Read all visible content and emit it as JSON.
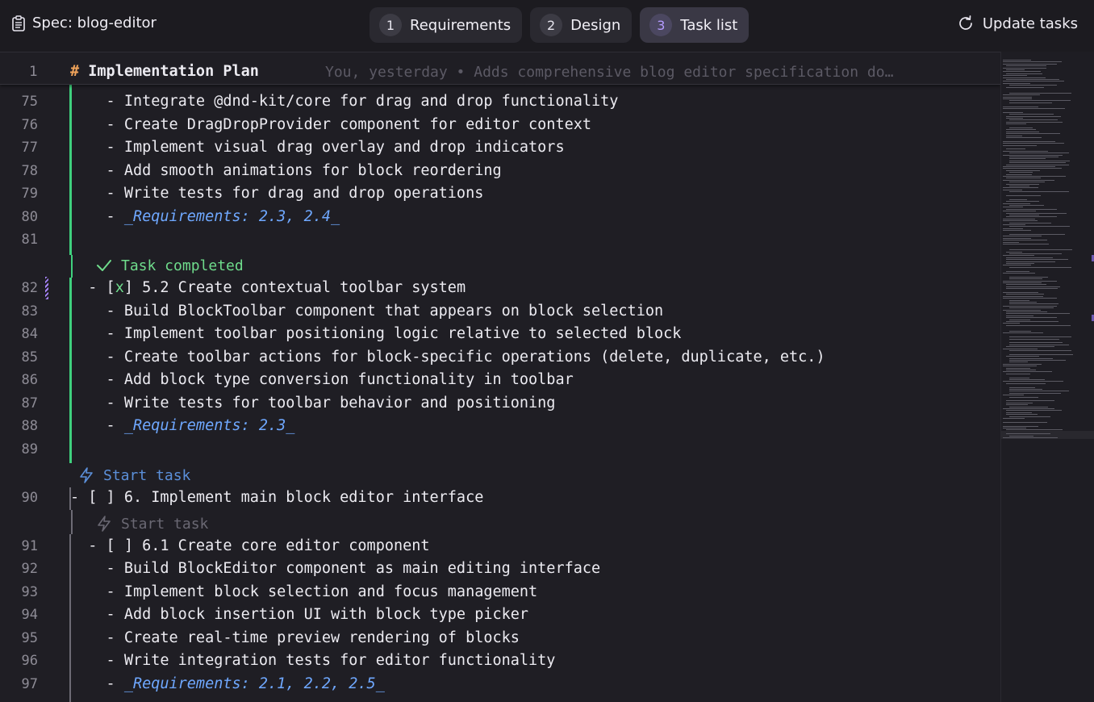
{
  "header": {
    "spec_title": "Spec: blog-editor",
    "tabs": [
      {
        "num": "1",
        "label": "Requirements"
      },
      {
        "num": "2",
        "label": "Design"
      },
      {
        "num": "3",
        "label": "Task list"
      }
    ],
    "update_label": "Update tasks"
  },
  "sticky": {
    "line_number": "1",
    "hash": "#",
    "text": " Implementation Plan",
    "blame": "You, yesterday • Adds comprehensive blog editor specification do…"
  },
  "lines": [
    {
      "n": "75",
      "t": "    - Integrate @dnd-kit/core for drag and drop functionality"
    },
    {
      "n": "76",
      "t": "    - Create DragDropProvider component for editor context"
    },
    {
      "n": "77",
      "t": "    - Implement visual drag overlay and drop indicators"
    },
    {
      "n": "78",
      "t": "    - Add smooth animations for block reordering"
    },
    {
      "n": "79",
      "t": "    - Write tests for drag and drop operations"
    },
    {
      "n": "80",
      "p": "    - ",
      "r": "_Requirements: 2.3, 2.4_"
    },
    {
      "n": "81",
      "t": ""
    },
    {
      "n": "82",
      "p": "  - [",
      "x": "x",
      "s": "] 5.2 Create contextual toolbar system"
    },
    {
      "n": "83",
      "t": "    - Build BlockToolbar component that appears on block selection"
    },
    {
      "n": "84",
      "t": "    - Implement toolbar positioning logic relative to selected block"
    },
    {
      "n": "85",
      "t": "    - Create toolbar actions for block-specific operations (delete, duplicate, etc.)"
    },
    {
      "n": "86",
      "t": "    - Add block type conversion functionality in toolbar"
    },
    {
      "n": "87",
      "t": "    - Write tests for toolbar behavior and positioning"
    },
    {
      "n": "88",
      "p": "    - ",
      "r": "_Requirements: 2.3_"
    },
    {
      "n": "89",
      "t": ""
    },
    {
      "n": "90",
      "t": "- [ ] 6. Implement main block editor interface"
    },
    {
      "n": "91",
      "t": "  - [ ] 6.1 Create core editor component"
    },
    {
      "n": "92",
      "t": "    - Build BlockEditor component as main editing interface"
    },
    {
      "n": "93",
      "t": "    - Implement block selection and focus management"
    },
    {
      "n": "94",
      "t": "    - Add block insertion UI with block type picker"
    },
    {
      "n": "95",
      "t": "    - Create real-time preview rendering of blocks"
    },
    {
      "n": "96",
      "t": "    - Write integration tests for editor functionality"
    },
    {
      "n": "97",
      "p": "    - ",
      "r": "_Requirements: 2.1, 2.2, 2.5_"
    }
  ],
  "codelens": {
    "task_completed": "Task completed",
    "start_task_6": "Start task",
    "start_task_61": "Start task"
  },
  "colors": {
    "background": "#1f1e24",
    "accent": "#b49bff",
    "green": "#3fd07d",
    "requirement": "#6fa8ff",
    "start_task_active": "#5b8fd9"
  }
}
